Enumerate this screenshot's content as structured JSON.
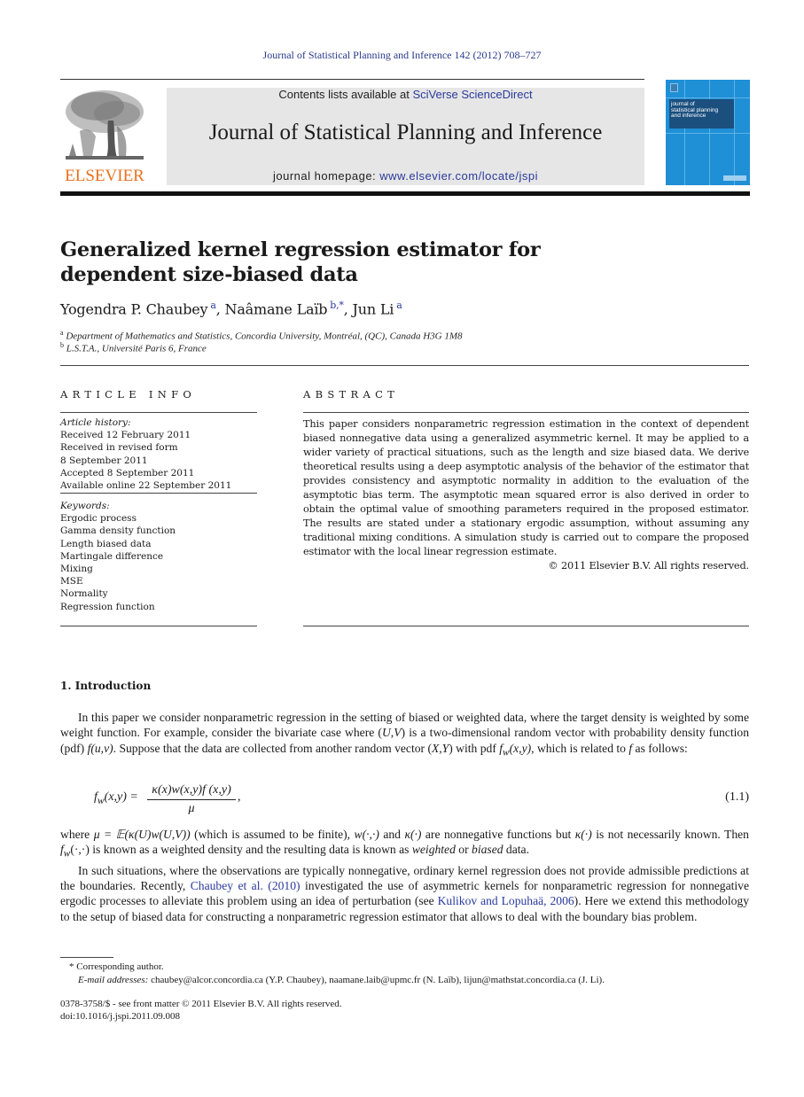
{
  "running_head": "Journal of Statistical Planning and Inference 142 (2012) 708–727",
  "publisher": {
    "logo_icon": "elsevier-tree-icon",
    "name": "ELSEVIER",
    "brand_color": "#e8701e"
  },
  "banner": {
    "contents_prefix": "Contents lists available at ",
    "contents_link": "SciVerse ScienceDirect",
    "journal_title": "Journal of Statistical Planning and Inference",
    "homepage_prefix": "journal homepage: ",
    "homepage_link": "www.elsevier.com/locate/jspi",
    "link_color": "#2a3a9c"
  },
  "cover": {
    "title_lines": [
      "journal of",
      "statistical planning",
      "and inference"
    ],
    "color": "#1f8fd6"
  },
  "article": {
    "title": "Generalized kernel regression estimator for dependent size-biased data",
    "authors": [
      {
        "name": "Yogendra P. Chaubey",
        "sup": "a"
      },
      {
        "name": "Naâmane Laïb",
        "sup": "b,*"
      },
      {
        "name": "Jun Li",
        "sup": "a"
      }
    ],
    "affiliations": [
      {
        "sup": "a",
        "text": "Department of Mathematics and Statistics, Concordia University, Montréal, (QC), Canada H3G 1M8"
      },
      {
        "sup": "b",
        "text": "L.S.T.A., Université Paris 6, France"
      }
    ]
  },
  "article_info": {
    "heading": "ARTICLE INFO",
    "history_label": "Article history:",
    "history": [
      "Received 12 February 2011",
      "Received in revised form",
      "8 September 2011",
      "Accepted 8 September 2011",
      "Available online 22 September 2011"
    ],
    "keywords_label": "Keywords:",
    "keywords": [
      "Ergodic process",
      "Gamma density function",
      "Length biased data",
      "Martingale difference",
      "Mixing",
      "MSE",
      "Normality",
      "Regression function"
    ]
  },
  "abstract": {
    "heading": "ABSTRACT",
    "text": "This paper considers nonparametric regression estimation in the context of dependent biased nonnegative data using a generalized asymmetric kernel. It may be applied to a wider variety of practical situations, such as the length and size biased data. We derive theoretical results using a deep asymptotic analysis of the behavior of the estimator that provides consistency and asymptotic normality in addition to the evaluation of the asymptotic bias term. The asymptotic mean squared error is also derived in order to obtain the optimal value of smoothing parameters required in the proposed estimator. The results are stated under a stationary ergodic assumption, without assuming any traditional mixing conditions. A simulation study is carried out to compare the proposed estimator with the local linear regression estimate.",
    "copyright": "© 2011 Elsevier B.V. All rights reserved."
  },
  "introduction": {
    "heading": "1.  Introduction",
    "p1_a": "In this paper we consider nonparametric regression in the setting of biased or weighted data, where the target density is weighted by some weight function. For example, consider the bivariate case where (",
    "p1_U": "U",
    "p1_b": ",",
    "p1_V": "V",
    "p1_c": ") is a two-dimensional random vector with probability density function (pdf) ",
    "p1_fuv": "f(u,v)",
    "p1_d": ". Suppose that the data are collected from another random vector (",
    "p1_XY": "X,Y",
    "p1_e": ") with pdf ",
    "p1_fw": "f",
    "p1_w": "w",
    "p1_xy": "(x,y)",
    "p1_f": ", which is related to ",
    "p1_f2": "f",
    "p1_g": " as follows:",
    "equation": {
      "lhs_f": "f",
      "lhs_sub": "w",
      "lhs_rest": "(x,y) =",
      "numerator": "κ(x)w(x,y)f (x,y)",
      "denominator": "μ",
      "trailing": ",",
      "number": "(1.1)"
    },
    "p2_a": "where ",
    "p2_mu": "μ = 𝔼(κ(U)w(U,V))",
    "p2_b": " (which is assumed to be finite), ",
    "p2_w": "w(·,·)",
    "p2_c": " and ",
    "p2_k": "κ(·)",
    "p2_d": " are nonnegative functions but ",
    "p2_k2": "κ(·)",
    "p2_e": " is not necessarily known. Then ",
    "p2_fw": "f",
    "p2_fw_sub": "w",
    "p2_fw_rest": "(·,·)",
    "p2_f": " is known as a weighted density and the resulting data is known as ",
    "p2_weighted": "weighted",
    "p2_or": " or ",
    "p2_biased": "biased",
    "p2_g": " data.",
    "p3_a": "In such situations, where the observations are typically nonnegative, ordinary kernel regression does not provide admissible predictions at the boundaries. Recently, ",
    "p3_link1": "Chaubey et al. (2010)",
    "p3_b": " investigated the use of asymmetric kernels for nonparametric regression for nonnegative ergodic processes to alleviate this problem using an idea of perturbation (see ",
    "p3_link2": "Kulikov and Lopuhaä, 2006",
    "p3_c": "). Here we extend this methodology to the setup of biased data for constructing a nonparametric regression estimator that allows to deal with the boundary bias problem."
  },
  "footnotes": {
    "corresponding": "* Corresponding author.",
    "email_label": "E-mail addresses:",
    "emails": " chaubey@alcor.concordia.ca (Y.P. Chaubey), naamane.laib@upmc.fr (N. Laïb), lijun@mathstat.concordia.ca (J. Li).",
    "issn": "0378-3758/$ - see front matter © 2011 Elsevier B.V. All rights reserved.",
    "doi": "doi:10.1016/j.jspi.2011.09.008"
  }
}
